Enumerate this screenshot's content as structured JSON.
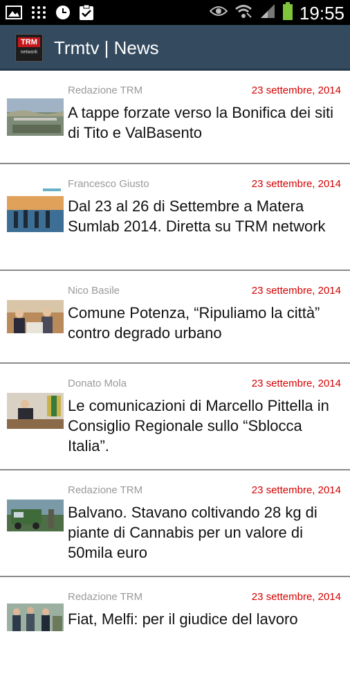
{
  "status_bar": {
    "time": "19:55",
    "left_icons": [
      "image-icon",
      "grid-icon",
      "clock-icon",
      "clipboard-check-icon"
    ],
    "right_icons": [
      "eye-icon",
      "wifi-icon",
      "signal-icon",
      "battery-icon"
    ]
  },
  "app_bar": {
    "logo_text": "TRM",
    "logo_subtext": "network",
    "title": "Trmtv | News"
  },
  "articles": [
    {
      "author": "Redazione TRM",
      "date": "23 settembre, 2014",
      "title": "A tappe forzate verso la Bonifica dei siti di Tito e ValBasento"
    },
    {
      "author": "Francesco Giusto",
      "date": "23 settembre, 2014",
      "title": "Dal 23 al 26 di Settembre a Matera Sumlab 2014. Diretta su TRM network"
    },
    {
      "author": "Nico Basile",
      "date": "23 settembre, 2014",
      "title": "Comune Potenza, “Ripuliamo la città” contro degrado urbano"
    },
    {
      "author": "Donato Mola",
      "date": "23 settembre, 2014",
      "title": "Le comunicazioni di Marcello Pittella in Consiglio Regionale sullo “Sblocca Italia”."
    },
    {
      "author": "Redazione TRM",
      "date": "23 settembre, 2014",
      "title": "Balvano. Stavano coltivando 28 kg di piante di Cannabis per un valore di 50mila euro"
    },
    {
      "author": "Redazione TRM",
      "date": "23 settembre, 2014",
      "title": "Fiat, Melfi: per il giudice del lavoro"
    }
  ],
  "colors": {
    "app_bar": "#334a5f",
    "date_red": "#d40000",
    "author_gray": "#999999"
  }
}
